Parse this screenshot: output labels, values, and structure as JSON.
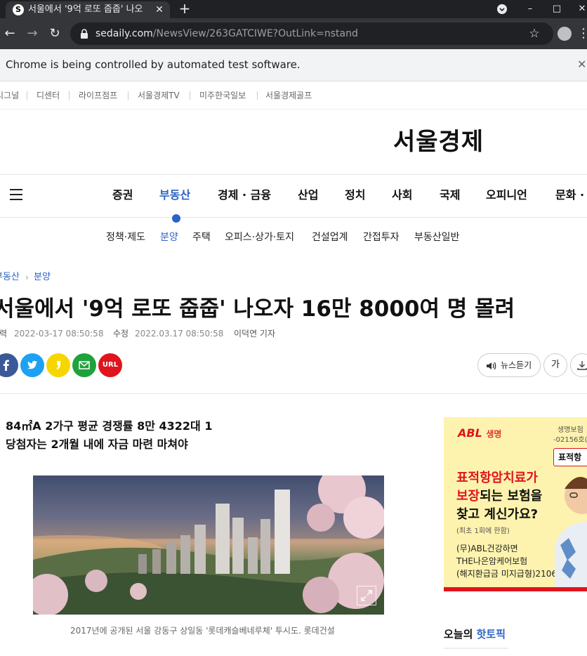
{
  "browser": {
    "tab_title": "서울에서 '9억 로또 줍줍' 나오",
    "favicon_letter": "S",
    "url_host": "sedaily.com",
    "url_path": "/NewsView/263GATCIWE?OutLink=nstand",
    "infobar_text": "Chrome is being controlled by automated test software."
  },
  "family_links": [
    "시그널",
    "디센터",
    "라이프점프",
    "서울경제TV",
    "미주한국일보",
    "서울경제골프"
  ],
  "logo": "서울경제",
  "gnb": [
    "증권",
    "부동산",
    "경제 · 금융",
    "산업",
    "정치",
    "사회",
    "국제",
    "오피니언",
    "문화 ·"
  ],
  "gnb_active": "부동산",
  "subnav": [
    "정책·제도",
    "분양",
    "주택",
    "오피스·상가·토지",
    "건설업계",
    "간접투자",
    "부동산일반"
  ],
  "subnav_active": "분양",
  "breadcrumb": [
    "부동산",
    "분양"
  ],
  "article": {
    "headline": "서울에서 '9억 로또 줍줍' 나오자 16만 8000여 명 몰려",
    "input_label": "입력",
    "input_time": "2022-03-17 08:50:58",
    "modify_label": "수정",
    "modify_time": "2022.03.17 08:50:58",
    "author": "이덕연 기자",
    "summary_1": "84㎡A 2가구 평균 경쟁률 8만 4322대 1",
    "summary_2": "당첨자는 2개월 내에 자금 마련 마쳐야",
    "caption": "2017년에 공개된 서울 강동구 상일동 '롯데캐슬베네루체' 투시도. 롯데건설"
  },
  "share": {
    "url_label": "URL"
  },
  "tools": {
    "listen_label": "뉴스듣기",
    "font_label": "가"
  },
  "ad": {
    "brand": "ABL",
    "brand_suffix": "생명",
    "small_1": "생명보험",
    "small_2": "-02156호(2",
    "tag": "표적항",
    "line_1": "표적항암치료가",
    "line_2a": "보장",
    "line_2b": "되는 보험을",
    "line_3": "찾고 계신가요?",
    "note": "(최초 1회에 한함)",
    "prod_1": "(무)ABL건강하면",
    "prod_2": "THE나은암케어보험",
    "prod_3": "(해지환급금 미지급형)2106"
  },
  "hot_topic": {
    "prefix": "오늘의 ",
    "accent": "핫토픽"
  },
  "colors": {
    "accent": "#2b63c6",
    "facebook": "#3b5998",
    "twitter": "#1da1f2",
    "kakao": "#f7d600",
    "mail": "#1fa23c",
    "url": "#e0141d"
  }
}
